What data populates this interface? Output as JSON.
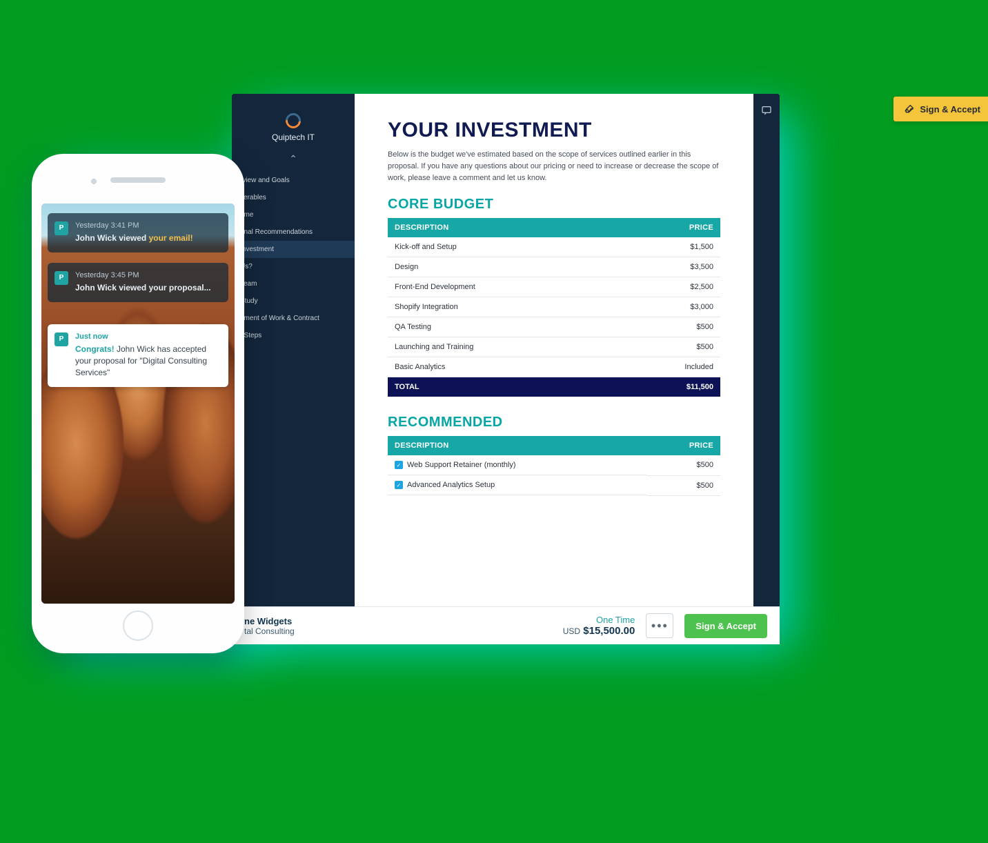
{
  "app": {
    "brand": "Quiptech IT",
    "nav": [
      "rview and Goals",
      "verables",
      "ame",
      "onal Recommendations",
      "Investment",
      "Us?",
      "Team",
      "Study",
      "ement of Work & Contract",
      "t Steps"
    ],
    "nav_active_index": 4,
    "sign_tab": "Sign & Accept"
  },
  "document": {
    "title": "YOUR INVESTMENT",
    "description": "Below is the budget we've estimated based on the scope of services outlined earlier in this proposal. If you have any questions about our pricing or need to increase or decrease the scope of work, please leave a comment and let us know.",
    "core": {
      "title": "CORE BUDGET",
      "col_desc": "DESCRIPTION",
      "col_price": "PRICE",
      "rows": [
        {
          "desc": "Kick-off and Setup",
          "price": "$1,500"
        },
        {
          "desc": "Design",
          "price": "$3,500"
        },
        {
          "desc": "Front-End Development",
          "price": "$2,500"
        },
        {
          "desc": "Shopify Integration",
          "price": "$3,000"
        },
        {
          "desc": "QA Testing",
          "price": "$500"
        },
        {
          "desc": "Launching and Training",
          "price": "$500"
        },
        {
          "desc": "Basic Analytics",
          "price": "Included"
        }
      ],
      "total_label": "TOTAL",
      "total_value": "$11,500"
    },
    "recommended": {
      "title": "RECOMMENDED",
      "col_desc": "DESCRIPTION",
      "col_price": "PRICE",
      "rows": [
        {
          "desc": "Web Support Retainer (monthly)",
          "price": "$500",
          "checked": true
        },
        {
          "desc": "Advanced Analytics Setup",
          "price": "$500",
          "checked": true
        }
      ]
    }
  },
  "bottombar": {
    "company1": "ne Widgets",
    "company2": "tal Consulting",
    "price_label": "One Time",
    "currency": "USD",
    "amount": "$15,500.00",
    "sign": "Sign & Accept"
  },
  "phone": {
    "notifications": [
      {
        "time": "Yesterday 3:41 PM",
        "line1": "John Wick viewed ",
        "highlight": "your email!",
        "style": "dark"
      },
      {
        "time": "Yesterday 3:45 PM",
        "line1": "John Wick viewed your proposal...",
        "style": "dark"
      },
      {
        "time": "Just now",
        "congrats": "Congrats! ",
        "body": "John Wick has accepted your proposal for \"Digital Consulting Services\"",
        "style": "white"
      }
    ]
  }
}
